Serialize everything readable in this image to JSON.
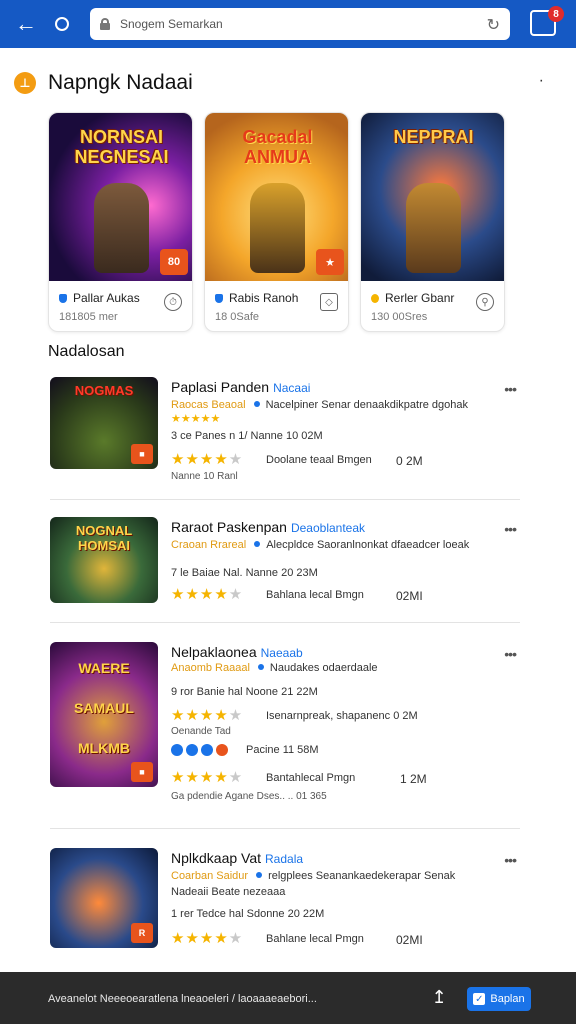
{
  "browser": {
    "url_text": "Snogem Semarkan",
    "tabs_count": "8"
  },
  "section": {
    "logo_glyph": "⊥",
    "title": "Napngk Nadaai"
  },
  "featured": [
    {
      "art_title": "NORNSAI NEGNESAI",
      "badge": "80",
      "name": "Pallar Aukas",
      "meta": "181805 mer",
      "shield_color": "#1a73e8"
    },
    {
      "art_title": "Gacadal ANMUA",
      "badge": "",
      "name": "Rabis Ranoh",
      "meta": "18 0Safe",
      "shield_color": "#1a73e8"
    },
    {
      "art_title": "NEPPRAI",
      "badge": "",
      "name": "Rerler Gbanr",
      "meta": "130 00Sres",
      "shield_color": "#f5b400"
    }
  ],
  "list": {
    "label": "Nadalosan",
    "items": [
      {
        "thumb_title": "NOGMAS",
        "thumb_badge": "",
        "title": "Paplasi Panden",
        "tag": "Nacaai",
        "line1_orange": "Raocas Beaoal",
        "line1_rest": "Nacelpiner Senar denaakdikpatre dgohak",
        "stars_small": "★★★★★",
        "line2": "3 ce Panes n 1/ Nanne 10 02M",
        "rating_label": "Doolane teaal Bmgen",
        "size": "0 2M",
        "footer": "Nanne 10 Ranl"
      },
      {
        "thumb_title": "NOGNAL HOMSAI",
        "thumb_badge": "",
        "title": "Raraot Paskenpan",
        "tag": "Deaoblanteak",
        "line1_orange": "Craoan Rrareal",
        "line1_rest": "Alecpldce Saoranlnonkat dfaeadcer loeak",
        "line2": "7 le Baiae Nal. Nanne 20 23M",
        "rating_label": "Bahlana lecal Bmgn",
        "size": "02MI"
      },
      {
        "thumb_title": "WAERE SAMAUL MLKMB",
        "thumb_badge": "",
        "title": "Nelpaklaonea",
        "tag": "Naeaab",
        "line1_orange": "Anaomb Raaaal",
        "line1_rest": "Naudakes odaerdaale",
        "line2": "9 ror Banie hal Noone 21 22M",
        "rating_label": "Isenarnpreak, shapanenc 0 2M",
        "sub_note": "Oenande Tad",
        "rating_label_2": "Pacine 11 58M",
        "rating_label_3": "Bantahlecal Pmgn",
        "size": "1 2M",
        "footer": "Ga pdendie Agane Dses.. .. 01 365"
      },
      {
        "thumb_title": "",
        "thumb_badge": "R",
        "title": "Nplkdkaap Vat",
        "tag": "Radala",
        "line1_orange": "Coarban Saidur",
        "line1_rest": "relgplees Seanankaedekerapar Senak",
        "line1b": "Nadeaii Beate nezeaaa",
        "line2": "1 rer Tedce hal Sdonne 20 22M",
        "rating_label": "Bahlane lecal Pmgn",
        "size": "02MI"
      }
    ]
  },
  "bottom": {
    "text": "Aveanelot Neeeoearatlena lneaoeleri / laoaaaeaebori...",
    "button_label": "Baplan"
  }
}
